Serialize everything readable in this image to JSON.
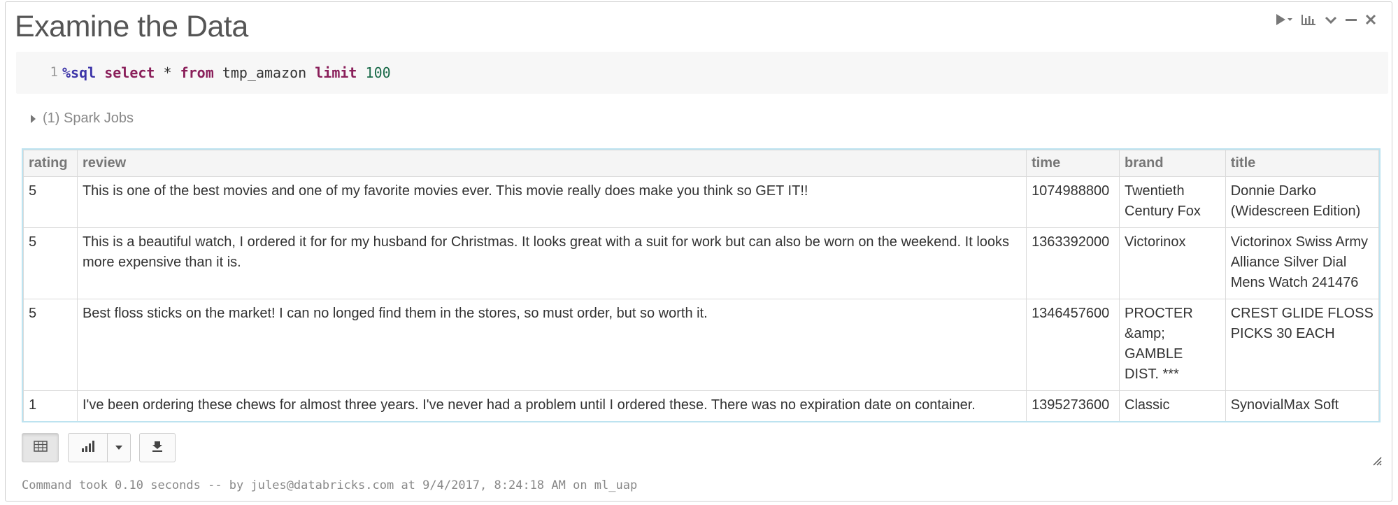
{
  "cell": {
    "title": "Examine the Data"
  },
  "editor": {
    "line_number": "1",
    "code_tokens": {
      "magic": "%sql",
      "select": "select",
      "star": " * ",
      "from": "from",
      "table": " tmp_amazon ",
      "limit": "limit",
      "space": " ",
      "limit_value": "100"
    }
  },
  "jobs": {
    "label": "(1) Spark Jobs"
  },
  "results": {
    "columns": [
      "rating",
      "review",
      "time",
      "brand",
      "title"
    ],
    "rows": [
      {
        "rating": "5",
        "review": "This is one of the best movies and one of my favorite movies ever. This movie really does make you think so GET IT!!",
        "time": "1074988800",
        "brand": "Twentieth Century Fox",
        "title": "Donnie Darko (Widescreen Edition)"
      },
      {
        "rating": "5",
        "review": "This is a beautiful watch, I ordered it for for my husband for Christmas. It looks great with a suit for work but can also be worn on the weekend. It looks more expensive than it is.",
        "time": "1363392000",
        "brand": "Victorinox",
        "title": "Victorinox Swiss Army Alliance Silver Dial Mens Watch 241476"
      },
      {
        "rating": "5",
        "review": "Best floss sticks on the market!  I can no longed find them in the stores, so must order, but so worth it.",
        "time": "1346457600",
        "brand": "PROCTER &amp; GAMBLE DIST. ***",
        "title": "CREST GLIDE FLOSS PICKS 30 EACH"
      },
      {
        "rating": "1",
        "review": "I've been ordering these chews for almost three years. I've never had a problem until I ordered these. There was no expiration date on container.",
        "time": "1395273600",
        "brand": "Classic",
        "title": "SynovialMax Soft"
      }
    ]
  },
  "footer": {
    "text": "Command took 0.10 seconds -- by jules@databricks.com at 9/4/2017, 8:24:18 AM on ml_uap"
  },
  "icons": [
    "run-icon",
    "chart-icon",
    "chevron-down-icon",
    "minimize-icon",
    "close-icon",
    "table-icon",
    "bar-chart-icon",
    "caret-down-icon",
    "download-icon",
    "resize-handle-icon"
  ]
}
